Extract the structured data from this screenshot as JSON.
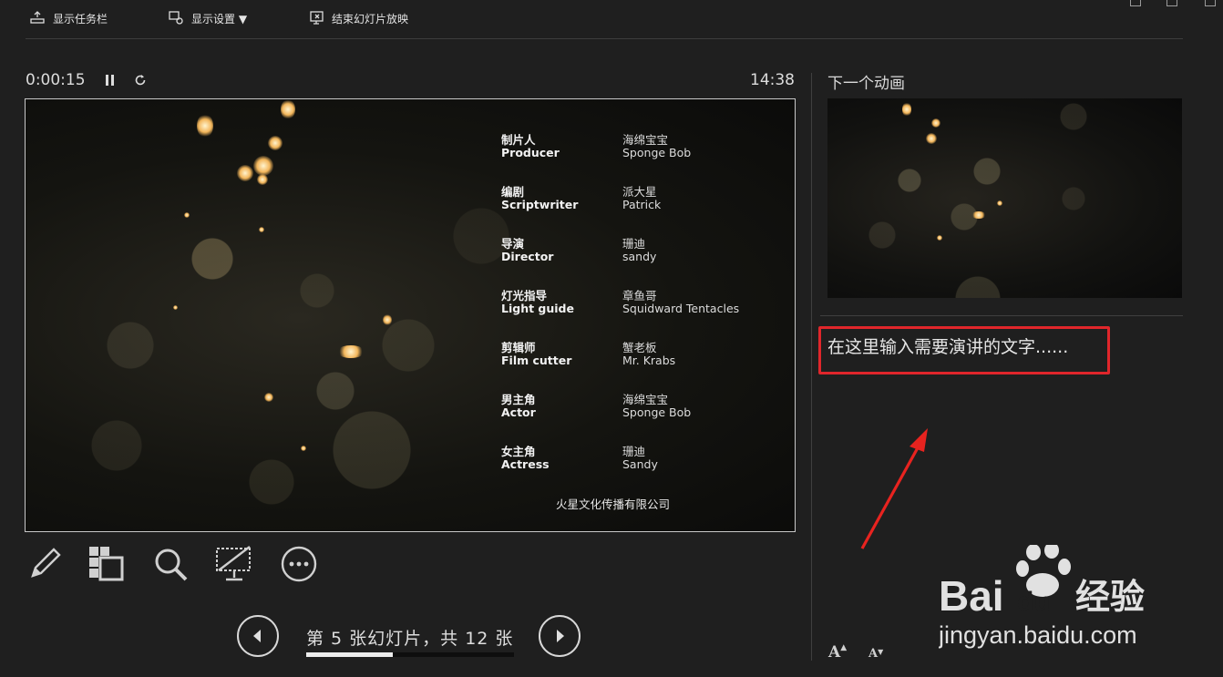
{
  "toolbar": {
    "show_taskbar": "显示任务栏",
    "display_settings": "显示设置 ▼",
    "end_slideshow": "结束幻灯片放映"
  },
  "presenter": {
    "elapsed": "0:00:15",
    "clock": "14:38"
  },
  "slide": {
    "credits": [
      {
        "role_cn": "制片人",
        "role_en": "Producer",
        "name_cn": "海绵宝宝",
        "name_en": "Sponge Bob"
      },
      {
        "role_cn": "编剧",
        "role_en": "Scriptwriter",
        "name_cn": "派大星",
        "name_en": "Patrick"
      },
      {
        "role_cn": "导演",
        "role_en": "Director",
        "name_cn": "珊迪",
        "name_en": "sandy"
      },
      {
        "role_cn": "灯光指导",
        "role_en": "Light guide",
        "name_cn": "章鱼哥",
        "name_en": "Squidward Tentacles"
      },
      {
        "role_cn": "剪辑师",
        "role_en": "Film cutter",
        "name_cn": "蟹老板",
        "name_en": "Mr. Krabs"
      },
      {
        "role_cn": "男主角",
        "role_en": "Actor",
        "name_cn": "海绵宝宝",
        "name_en": "Sponge Bob"
      },
      {
        "role_cn": "女主角",
        "role_en": "Actress",
        "name_cn": "珊迪",
        "name_en": "Sandy"
      }
    ],
    "company": "火星文化传播有限公司"
  },
  "navigation": {
    "slide_count": "第 5 张幻灯片，共 12 张",
    "progress": 0.4167
  },
  "next_panel": {
    "title": "下一个动画"
  },
  "notes": {
    "text": "在这里输入需要演讲的文字......"
  },
  "font_controls": {
    "increase": "A",
    "decrease": "A"
  },
  "watermark": {
    "brand": "Bai du 经验",
    "url": "jingyan.baidu.com"
  },
  "colors": {
    "background": "#1f1f1f",
    "highlight_box": "#e0262b",
    "annotation_arrow": "#e8231f"
  },
  "icons": [
    "taskbar-icon",
    "display-settings-icon",
    "end-show-icon",
    "pause-icon",
    "restart-icon",
    "pen-icon",
    "slides-grid-icon",
    "zoom-icon",
    "black-screen-icon",
    "more-icon",
    "prev-arrow-icon",
    "next-arrow-icon"
  ]
}
